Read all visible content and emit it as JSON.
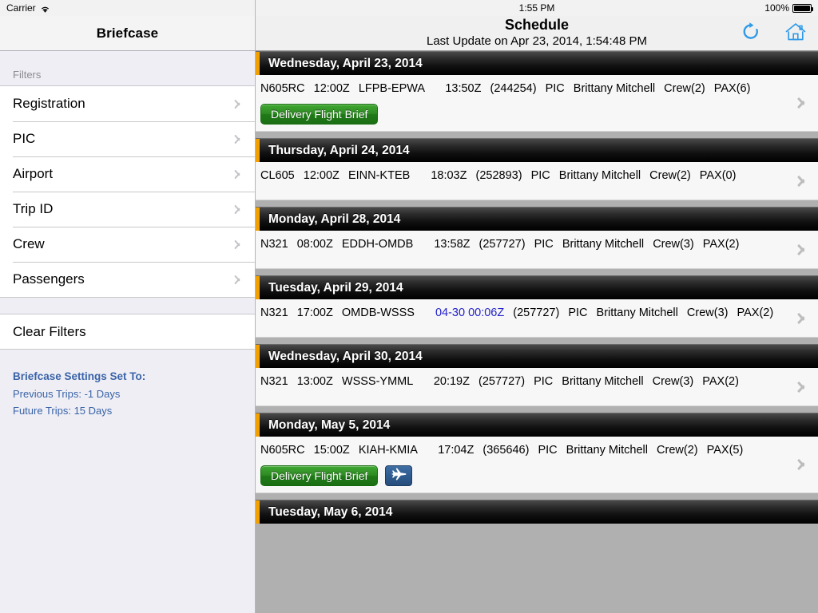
{
  "status_bar": {
    "carrier": "Carrier",
    "wifi_icon": "wifi-icon",
    "time": "1:55 PM",
    "battery_percent": "100%",
    "battery_icon": "battery-full-icon"
  },
  "sidebar": {
    "title": "Briefcase",
    "section_header": "Filters",
    "items": [
      {
        "label": "Registration",
        "chevron_icon": "chevron-right-icon"
      },
      {
        "label": "PIC",
        "chevron_icon": "chevron-right-icon"
      },
      {
        "label": "Airport",
        "chevron_icon": "chevron-right-icon"
      },
      {
        "label": "Trip ID",
        "chevron_icon": "chevron-right-icon"
      },
      {
        "label": "Crew",
        "chevron_icon": "chevron-right-icon"
      },
      {
        "label": "Passengers",
        "chevron_icon": "chevron-right-icon"
      }
    ],
    "clear_filters_label": "Clear Filters",
    "settings": {
      "title": "Briefcase Settings Set To:",
      "previous_trips": "Previous Trips: -1 Days",
      "future_trips": "Future Trips: 15 Days",
      "accent_color": "#3a63a8"
    }
  },
  "header": {
    "title": "Schedule",
    "subtitle": "Last Update on Apr 23, 2014, 1:54:48 PM",
    "refresh_icon": "refresh-icon",
    "home_icon": "home-icon",
    "icon_color": "#2f9ae8"
  },
  "colors": {
    "day_accent": "#f2a000",
    "green_button": "#2e8a22",
    "plane_button": "#2f5c90",
    "highlight_time": "#2222cc"
  },
  "schedule": {
    "days": [
      {
        "date_label": "Wednesday, April 23, 2014",
        "flight": {
          "registration": "N605RC",
          "dep_time": "12:00Z",
          "route": "LFPB-EPWA",
          "arr_time": "13:50Z",
          "arr_time_highlight": false,
          "trip_id": "(244254)",
          "pic_label": "PIC",
          "pic_name": "Brittany Mitchell",
          "crew": "Crew(2)",
          "pax": "PAX(6)"
        },
        "buttons": {
          "brief_label": "Delivery Flight Brief",
          "has_brief": true,
          "has_plane": false,
          "plane_icon": "airplane-icon"
        },
        "chevron_icon": "chevron-right-icon"
      },
      {
        "date_label": "Thursday, April 24, 2014",
        "flight": {
          "registration": "CL605",
          "dep_time": "12:00Z",
          "route": "EINN-KTEB",
          "arr_time": "18:03Z",
          "arr_time_highlight": false,
          "trip_id": "(252893)",
          "pic_label": "PIC",
          "pic_name": "Brittany Mitchell",
          "crew": "Crew(2)",
          "pax": "PAX(0)"
        },
        "buttons": {
          "brief_label": "",
          "has_brief": false,
          "has_plane": false,
          "plane_icon": ""
        },
        "chevron_icon": "chevron-right-icon"
      },
      {
        "date_label": "Monday, April 28, 2014",
        "flight": {
          "registration": "N321",
          "dep_time": "08:00Z",
          "route": "EDDH-OMDB",
          "arr_time": "13:58Z",
          "arr_time_highlight": false,
          "trip_id": "(257727)",
          "pic_label": "PIC",
          "pic_name": "Brittany Mitchell",
          "crew": "Crew(3)",
          "pax": "PAX(2)"
        },
        "buttons": {
          "brief_label": "",
          "has_brief": false,
          "has_plane": false,
          "plane_icon": ""
        },
        "chevron_icon": "chevron-right-icon"
      },
      {
        "date_label": "Tuesday, April 29, 2014",
        "flight": {
          "registration": "N321",
          "dep_time": "17:00Z",
          "route": "OMDB-WSSS",
          "arr_time": "04-30 00:06Z",
          "arr_time_highlight": true,
          "trip_id": "(257727)",
          "pic_label": "PIC",
          "pic_name": "Brittany Mitchell",
          "crew": "Crew(3)",
          "pax": "PAX(2)"
        },
        "buttons": {
          "brief_label": "",
          "has_brief": false,
          "has_plane": false,
          "plane_icon": ""
        },
        "chevron_icon": "chevron-right-icon"
      },
      {
        "date_label": "Wednesday, April 30, 2014",
        "flight": {
          "registration": "N321",
          "dep_time": "13:00Z",
          "route": "WSSS-YMML",
          "arr_time": "20:19Z",
          "arr_time_highlight": false,
          "trip_id": "(257727)",
          "pic_label": "PIC",
          "pic_name": "Brittany Mitchell",
          "crew": "Crew(3)",
          "pax": "PAX(2)"
        },
        "buttons": {
          "brief_label": "",
          "has_brief": false,
          "has_plane": false,
          "plane_icon": ""
        },
        "chevron_icon": "chevron-right-icon"
      },
      {
        "date_label": "Monday, May 5, 2014",
        "flight": {
          "registration": "N605RC",
          "dep_time": "15:00Z",
          "route": "KIAH-KMIA",
          "arr_time": "17:04Z",
          "arr_time_highlight": false,
          "trip_id": "(365646)",
          "pic_label": "PIC",
          "pic_name": "Brittany Mitchell",
          "crew": "Crew(2)",
          "pax": "PAX(5)"
        },
        "buttons": {
          "brief_label": "Delivery Flight Brief",
          "has_brief": true,
          "has_plane": true,
          "plane_icon": "airplane-icon"
        },
        "chevron_icon": "chevron-right-icon"
      },
      {
        "date_label": "Tuesday, May 6, 2014",
        "flight": null,
        "buttons": {
          "brief_label": "",
          "has_brief": false,
          "has_plane": false,
          "plane_icon": ""
        },
        "chevron_icon": "chevron-right-icon"
      }
    ]
  }
}
